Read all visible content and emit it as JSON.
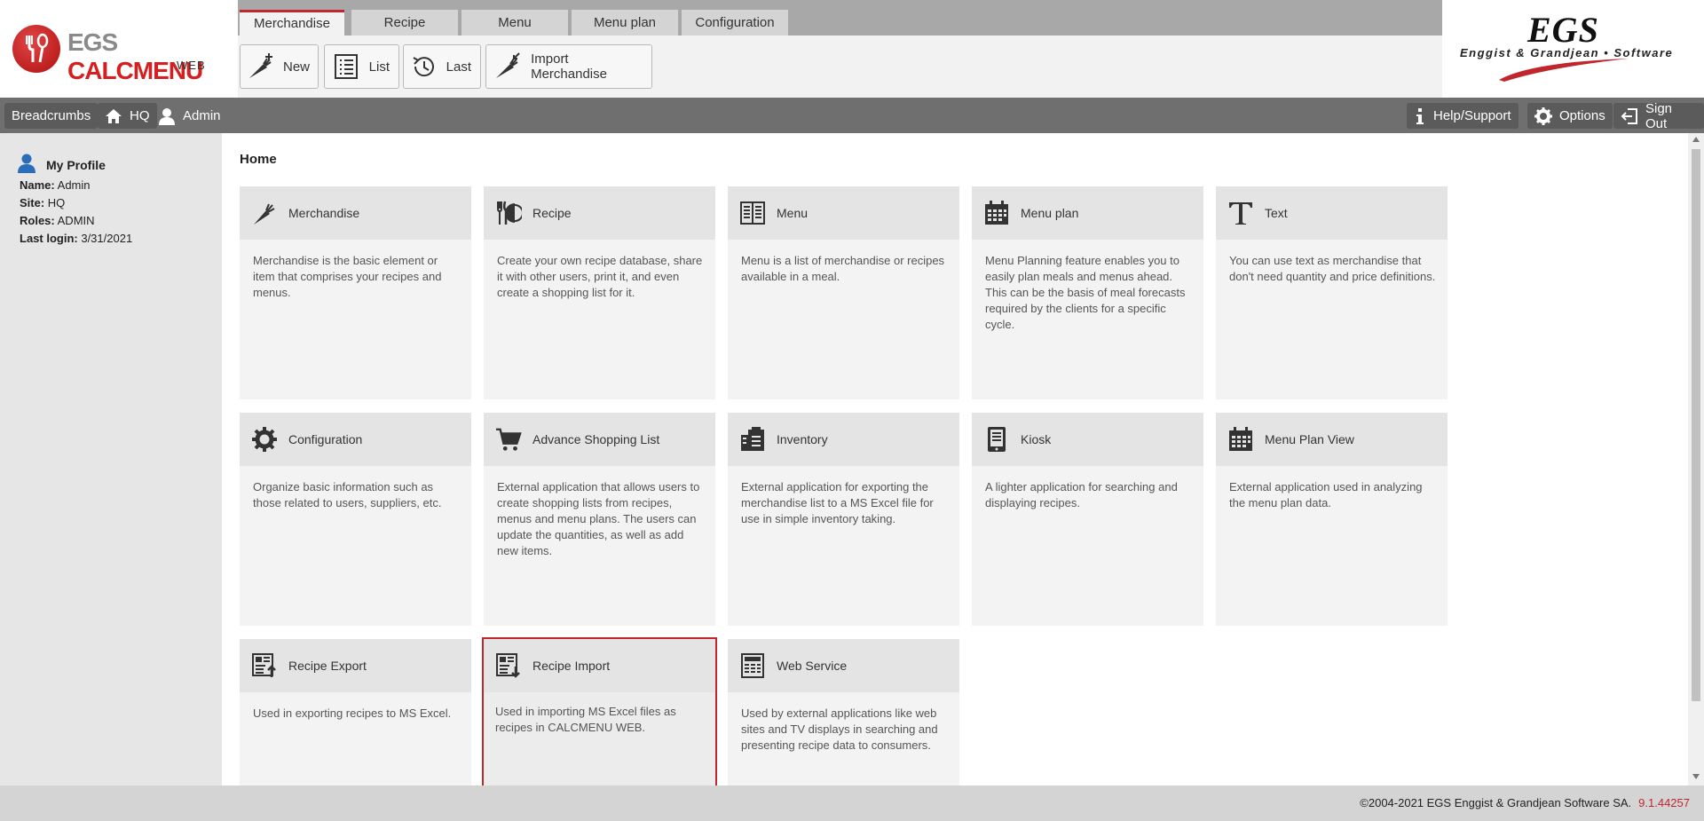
{
  "logo": {
    "brand_egs": "EGS ",
    "brand_calc": "CALCMENU",
    "sub": "WEB"
  },
  "tabs": [
    {
      "label": "Merchandise",
      "active": true
    },
    {
      "label": "Recipe",
      "active": false
    },
    {
      "label": "Menu",
      "active": false
    },
    {
      "label": "Menu plan",
      "active": false
    },
    {
      "label": "Configuration",
      "active": false
    }
  ],
  "toolbar": {
    "new_label": "New",
    "list_label": "List",
    "last_label": "Last",
    "import_label": "Import Merchandise"
  },
  "brand": {
    "name": "EGS",
    "sub": "Enggist & Grandjean • Software"
  },
  "navbar": {
    "breadcrumbs_label": "Breadcrumbs",
    "hq_label": "HQ",
    "admin_label": "Admin",
    "help_label": "Help/Support",
    "options_label": "Options",
    "signout_label": "Sign Out"
  },
  "profile": {
    "title": "My Profile",
    "name_key": "Name:",
    "name_val": "Admin",
    "site_key": "Site:",
    "site_val": "HQ",
    "roles_key": "Roles:",
    "roles_val": "ADMIN",
    "login_key": "Last login:",
    "login_val": "3/31/2021"
  },
  "main": {
    "title": "Home",
    "cards": [
      {
        "title": "Merchandise",
        "icon": "carrot-icon",
        "desc": "Merchandise is the basic element or item that comprises your recipes and menus."
      },
      {
        "title": "Recipe",
        "icon": "fork-plate-icon",
        "desc": "Create your own recipe database, share it with other users, print it, and even create a shopping list for it."
      },
      {
        "title": "Menu",
        "icon": "menu-book-icon",
        "desc": "Menu is a list of merchandise or recipes available in a meal."
      },
      {
        "title": "Menu plan",
        "icon": "calendar-icon",
        "desc": "Menu Planning feature enables you to easily plan meals and menus ahead. This can be the basis of meal forecasts required by the clients for a specific cycle."
      },
      {
        "title": "Text",
        "icon": "text-t-icon",
        "desc": "You can use text as merchandise that don't need quantity and price definitions."
      },
      {
        "title": "Configuration",
        "icon": "gear-icon",
        "desc": "Organize basic information such as those related to users, suppliers, etc."
      },
      {
        "title": "Advance Shopping List",
        "icon": "cart-icon",
        "desc": "External application that allows users to create shopping lists from recipes, menus and menu plans. The users can update the quantities, as well as add new items."
      },
      {
        "title": "Inventory",
        "icon": "clipboard-icon",
        "desc": "External application for exporting the merchandise list to a MS Excel file for use in simple inventory taking."
      },
      {
        "title": "Kiosk",
        "icon": "tablet-icon",
        "desc": "A lighter application for searching and displaying recipes."
      },
      {
        "title": "Menu Plan View",
        "icon": "calendar-view-icon",
        "desc": "External application used in analyzing the menu plan data."
      },
      {
        "title": "Recipe Export",
        "icon": "export-icon",
        "desc": "Used in exporting recipes to MS Excel."
      },
      {
        "title": "Recipe Import",
        "icon": "import-icon",
        "desc": "Used in importing MS Excel files as recipes in CALCMENU WEB."
      },
      {
        "title": "Web Service",
        "icon": "web-service-icon",
        "desc": "Used by external applications like web sites and TV displays in searching and presenting recipe data to consumers."
      }
    ]
  },
  "footer": {
    "copyright": "©2004-2021  EGS Enggist & Grandjean Software SA.",
    "version": "9.1.44257"
  },
  "colors": {
    "accent": "#c0272d",
    "navbar": "#6f6f6f",
    "sidebar": "#e6e6e6"
  }
}
